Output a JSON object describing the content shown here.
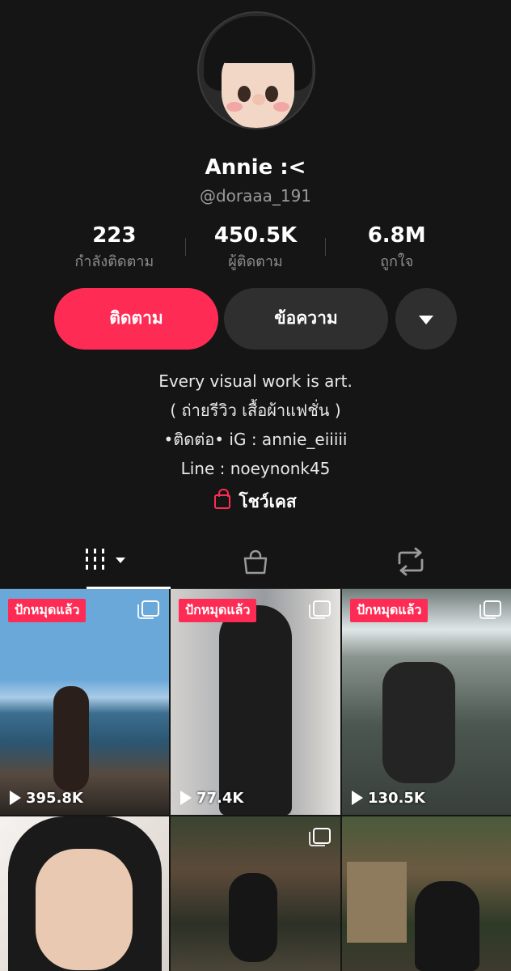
{
  "profile": {
    "name": "Annie :<",
    "handle": "@doraaa_191",
    "stats": [
      {
        "value": "223",
        "label": "กำลังติดตาม"
      },
      {
        "value": "450.5K",
        "label": "ผู้ติดตาม"
      },
      {
        "value": "6.8M",
        "label": "ถูกใจ"
      }
    ]
  },
  "actions": {
    "follow_label": "ติดตาม",
    "message_label": "ข้อความ",
    "more_icon": "chevron-down-icon"
  },
  "bio": {
    "lines": [
      "Every visual work is art.",
      "( ถ่ายรีวิว เสื้อผ้าแฟชั่น )",
      "•ติดต่อ• iG : annie_eiiiii",
      "Line : noeynonk45"
    ]
  },
  "showcase": {
    "label": "โชว์เคส",
    "icon": "shopping-bag-icon",
    "accent": "#fe2c55"
  },
  "tabs": [
    {
      "icon": "grid-icon",
      "active": true
    },
    {
      "icon": "shopping-bag-icon",
      "active": false
    },
    {
      "icon": "repost-icon",
      "active": false
    }
  ],
  "videos": [
    {
      "pinned_label": "ปักหมุดแล้ว",
      "multi": true,
      "views": "395.8K"
    },
    {
      "pinned_label": "ปักหมุดแล้ว",
      "multi": true,
      "views": "77.4K"
    },
    {
      "pinned_label": "ปักหมุดแล้ว",
      "multi": true,
      "views": "130.5K"
    },
    {
      "pinned_label": "",
      "multi": false,
      "views": ""
    },
    {
      "pinned_label": "",
      "multi": true,
      "views": ""
    },
    {
      "pinned_label": "",
      "multi": false,
      "views": ""
    }
  ],
  "colors": {
    "background": "#151515",
    "accent": "#fe2c55",
    "secondary_button": "#2f2f2f",
    "muted_text": "#8d8d8d"
  }
}
